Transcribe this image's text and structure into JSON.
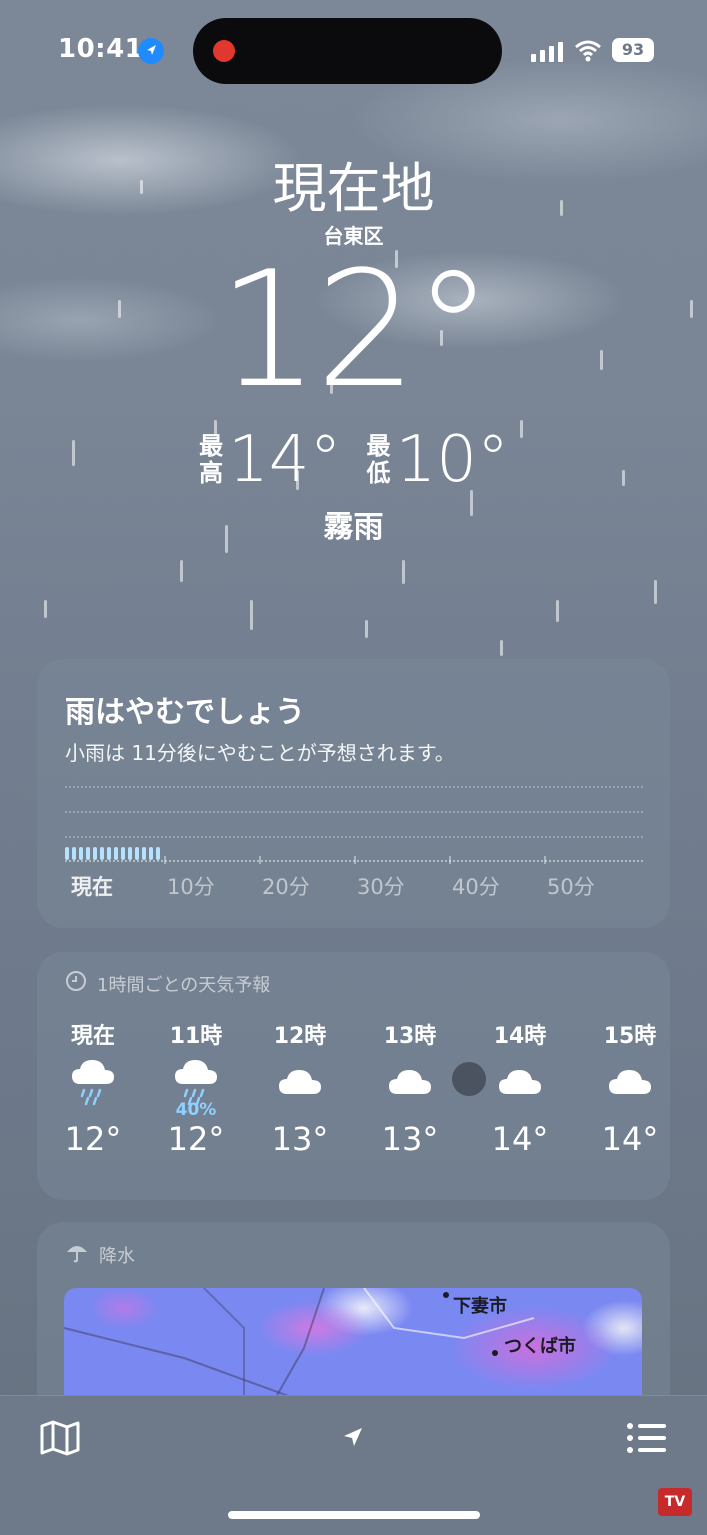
{
  "status_bar": {
    "time": "10:41",
    "battery": "93"
  },
  "location": {
    "title": "現在地",
    "district": "台東区"
  },
  "current": {
    "temp": "12°",
    "high_label": "最高",
    "high": "14°",
    "low_label": "最低",
    "low": "10°",
    "condition": "霧雨"
  },
  "precip_card": {
    "title": "雨はやむでしょう",
    "subtitle": "小雨は 11分後にやむことが予想されます。",
    "axis_labels": [
      "現在",
      "10分",
      "20分",
      "30分",
      "40分",
      "50分"
    ]
  },
  "hourly": {
    "header": "1時間ごとの天気予報",
    "items": [
      {
        "label": "現在",
        "icon": "cloud-rain-icon",
        "precip": "",
        "temp": "12°"
      },
      {
        "label": "11時",
        "icon": "cloud-rain-icon",
        "precip": "40%",
        "temp": "12°"
      },
      {
        "label": "12時",
        "icon": "cloud-icon",
        "precip": "",
        "temp": "13°"
      },
      {
        "label": "13時",
        "icon": "cloud-icon",
        "precip": "",
        "temp": "13°"
      },
      {
        "label": "14時",
        "icon": "cloud-icon",
        "precip": "",
        "temp": "14°"
      },
      {
        "label": "15時",
        "icon": "cloud-icon",
        "precip": "",
        "temp": "14°"
      }
    ]
  },
  "precip_map": {
    "header": "降水",
    "labels": [
      "下妻市",
      "つくば市"
    ]
  },
  "colors": {
    "accent_rain": "#b6e1ff",
    "percent": "#8fd0ff",
    "location_dot": "#1f8bff",
    "record": "#e2372f"
  },
  "watermark": "TV"
}
